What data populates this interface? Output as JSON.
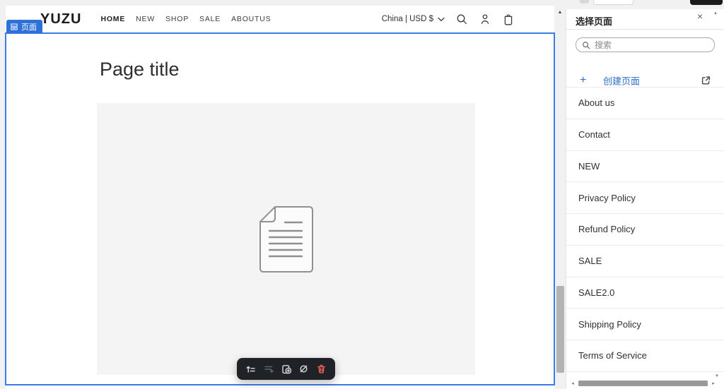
{
  "colors": {
    "selection_blue": "#3b7ce8",
    "badge_blue": "#2e72d9",
    "link_blue": "#2c6ecb",
    "toolbar_bg": "#1f2226",
    "delete_red": "#ef6159",
    "canvas_bg": "#f1f1f1",
    "placeholder_bg": "#f4f4f4"
  },
  "icons": {
    "close": "×",
    "plus": "+",
    "scroll_up": "▲",
    "scroll_down": "▼",
    "scroll_left": "◂",
    "scroll_right": "▸"
  },
  "editor": {
    "section_badge_label": "页面",
    "toolbar": {
      "buttons": [
        {
          "name": "move-up",
          "enabled": true
        },
        {
          "name": "move-down",
          "enabled": false
        },
        {
          "name": "duplicate",
          "enabled": true
        },
        {
          "name": "toggle-visibility",
          "enabled": true
        },
        {
          "name": "delete",
          "enabled": true
        }
      ]
    }
  },
  "preview": {
    "logo": "YUZU",
    "nav": [
      "HOME",
      "NEW",
      "SHOP",
      "SALE",
      "ABOUTUS"
    ],
    "locale": "China | USD $",
    "page_title": "Page title"
  },
  "panel": {
    "title": "选择页面",
    "search_placeholder": "搜索",
    "create_page_label": "创建页面",
    "pages": [
      "About us",
      "Contact",
      "NEW",
      "Privacy Policy",
      "Refund Policy",
      "SALE",
      "SALE2.0",
      "Shipping Policy",
      "Terms of Service"
    ]
  }
}
